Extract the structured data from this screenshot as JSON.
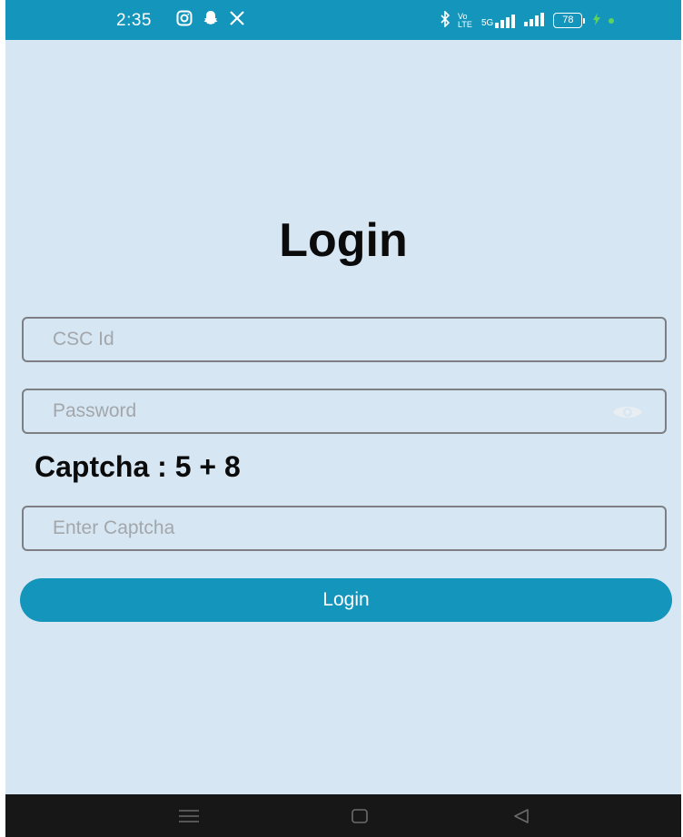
{
  "status_bar": {
    "time": "2:35",
    "left_icons": [
      "instagram-icon",
      "snapchat-icon",
      "x-icon"
    ],
    "right_icons": [
      "bluetooth-icon",
      "volte-icon",
      "5g-signal-icon",
      "signal-icon"
    ],
    "volte_label": "Vo LTE",
    "network_label": "5G",
    "battery": "78",
    "colors": {
      "bar": "#1495bb",
      "charging": "#5fd35f"
    }
  },
  "page": {
    "title": "Login",
    "background": "#d6e6f2"
  },
  "form": {
    "csc_id": {
      "value": "",
      "placeholder": "CSC Id"
    },
    "password": {
      "value": "",
      "placeholder": "Password",
      "toggle_icon": "eye-icon"
    },
    "captcha_label": "Captcha : 5 + 8",
    "captcha_input": {
      "value": "",
      "placeholder": "Enter Captcha"
    },
    "submit_label": "Login",
    "accent": "#1495bb"
  },
  "nav_bar": {
    "buttons": [
      "menu-icon",
      "home-icon",
      "back-icon"
    ],
    "background": "#171717"
  }
}
